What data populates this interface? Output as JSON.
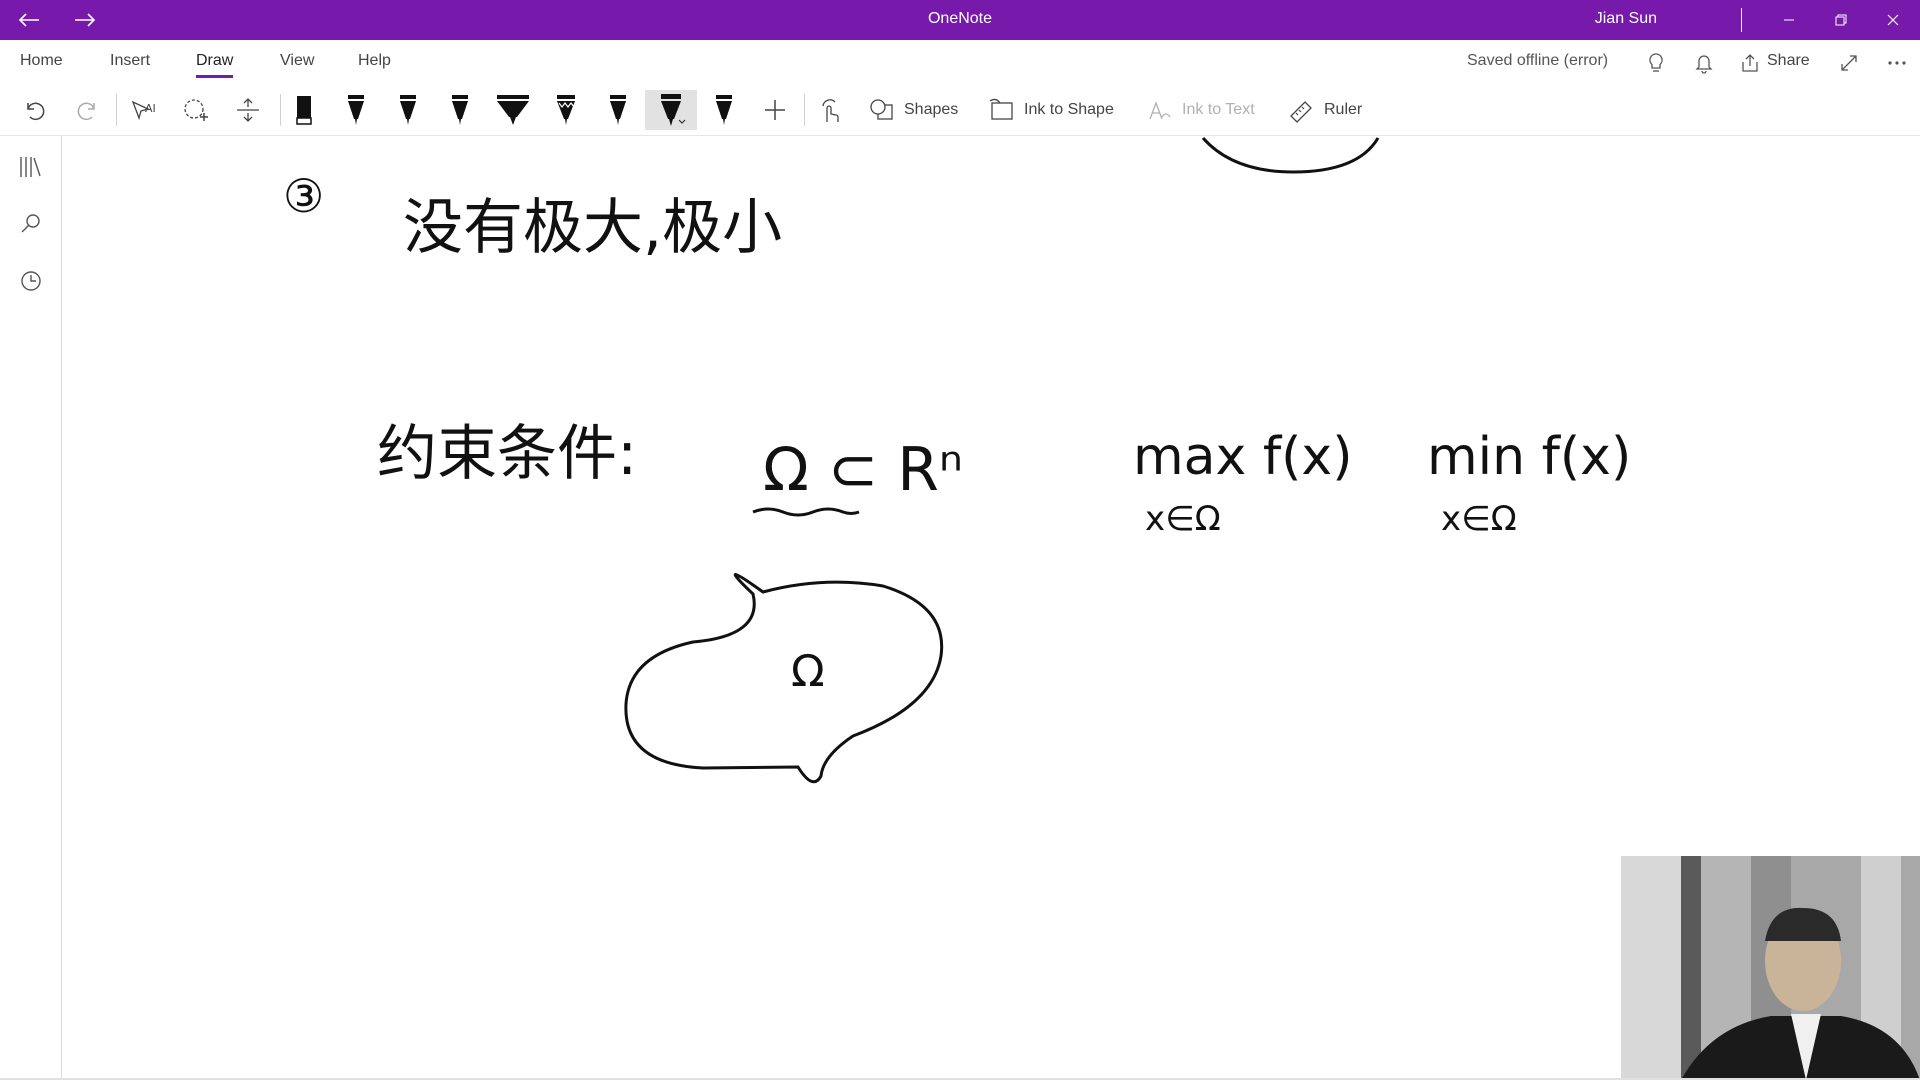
{
  "titlebar": {
    "app_title": "OneNote",
    "user_name": "Jian Sun",
    "back_icon": "arrow-left-icon",
    "forward_icon": "arrow-right-icon",
    "bg_color": "#7719aa"
  },
  "tabs": [
    {
      "label": "Home"
    },
    {
      "label": "Insert"
    },
    {
      "label": "Draw",
      "active": true
    },
    {
      "label": "View"
    },
    {
      "label": "Help"
    }
  ],
  "header": {
    "status": "Saved offline (error)",
    "share_label": "Share"
  },
  "toolbar": {
    "shapes_label": "Shapes",
    "ink_to_shape_label": "Ink to Shape",
    "ink_to_text_label": "Ink to Text",
    "ruler_label": "Ruler"
  },
  "note": {
    "item_number": "③",
    "line1": "没有极大,极小",
    "constraint_label": "约束条件:",
    "omega_subset": "Ω ⊂ Rⁿ",
    "max_expr": "max f(x)",
    "max_sub": "x∈Ω",
    "min_expr": "min f(x)",
    "min_sub": "x∈Ω",
    "region_label": "Ω"
  }
}
